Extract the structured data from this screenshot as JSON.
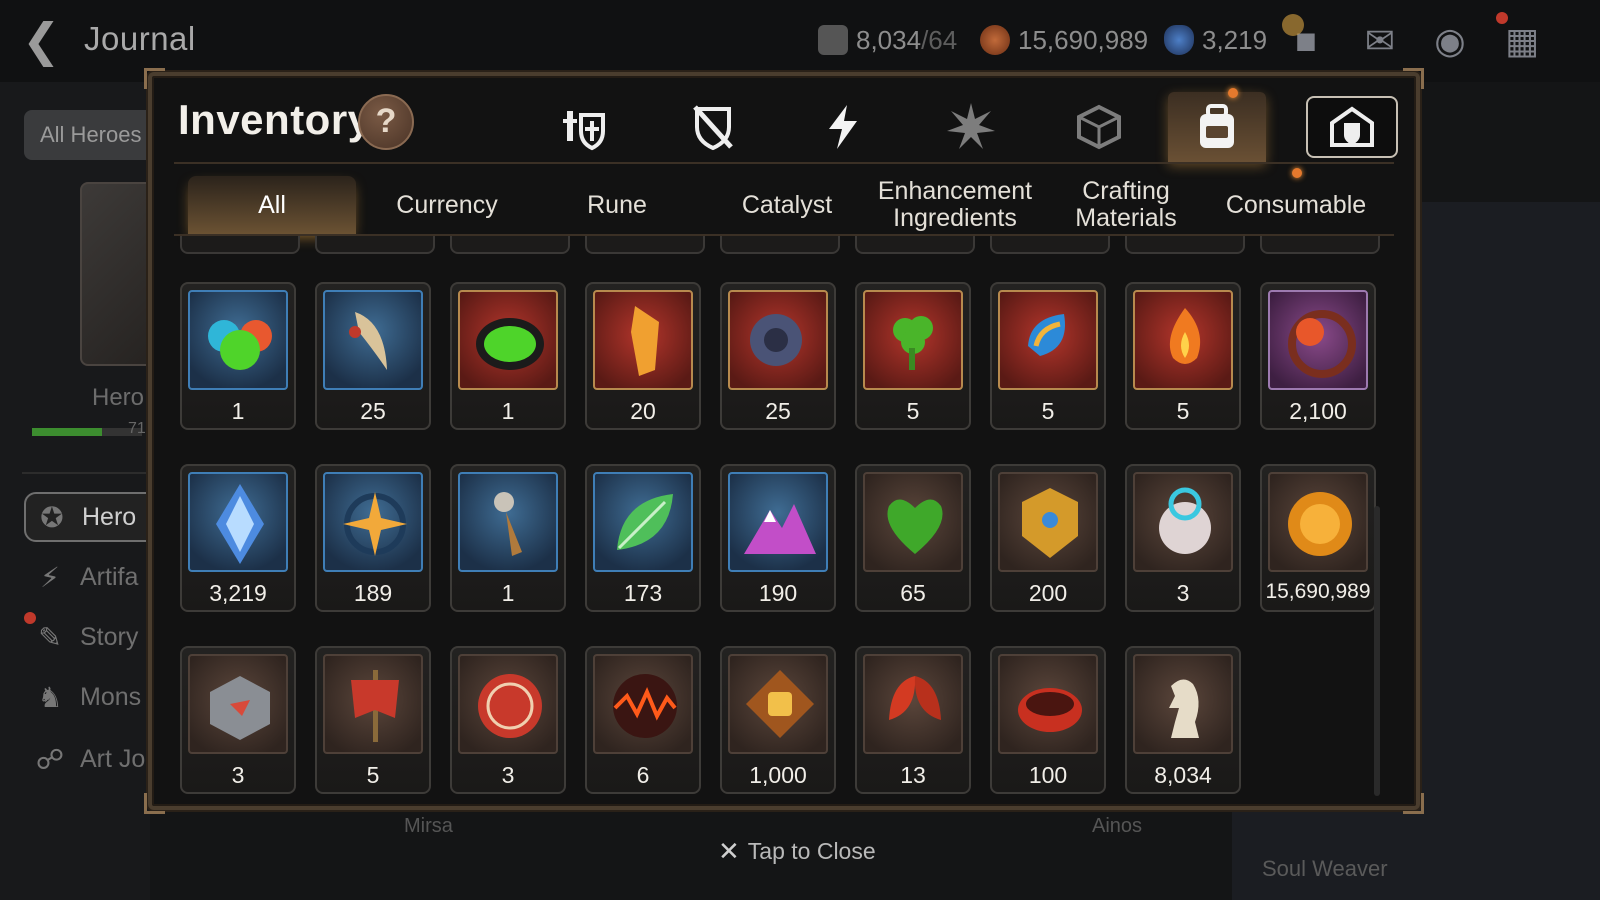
{
  "header": {
    "title": "Journal",
    "resources": [
      {
        "name": "stamina",
        "value": "8,034",
        "max": "/64",
        "color": "#8a8a8a"
      },
      {
        "name": "gold",
        "value": "15,690,989",
        "color": "#a0522d"
      },
      {
        "name": "skystone",
        "value": "3,219",
        "color": "#3b6cb5"
      }
    ]
  },
  "sidebar": {
    "filter_button": "All Heroes",
    "hero_label": "Hero",
    "progress_value": "71",
    "progress_fraction": 0.64,
    "items": [
      {
        "label": "Hero",
        "icon": "hero-icon"
      },
      {
        "label": "Artifa",
        "icon": "artifact-icon"
      },
      {
        "label": "Story",
        "icon": "story-icon"
      },
      {
        "label": "Mons",
        "icon": "monster-icon"
      },
      {
        "label": "Art Jo",
        "icon": "art-journal-icon"
      }
    ]
  },
  "background_labels": {
    "left_name": "Mirsa",
    "right_name": "Ainos",
    "soul_weaver": "Soul Weaver"
  },
  "inventory": {
    "title": "Inventory",
    "help": "?",
    "category_tabs": [
      {
        "icon": "knight-shield-icon"
      },
      {
        "icon": "crossed-weapon-shield-icon"
      },
      {
        "icon": "lightning-icon"
      },
      {
        "icon": "star-burst-icon"
      },
      {
        "icon": "cube-icon"
      },
      {
        "icon": "backpack-icon"
      },
      {
        "icon": "fortress-icon"
      }
    ],
    "subtabs": [
      {
        "label": "All"
      },
      {
        "label": "Currency"
      },
      {
        "label": "Rune"
      },
      {
        "label": "Catalyst"
      },
      {
        "label": "Enhancement Ingredients"
      },
      {
        "label": "Crafting Materials"
      },
      {
        "label": "Consumable"
      }
    ],
    "rows": [
      [
        {
          "qty": "1",
          "icon": "slime-orbs-icon"
        },
        {
          "qty": "25",
          "icon": "ginseng-root-icon"
        },
        {
          "qty": "1",
          "icon": "green-potion-icon"
        },
        {
          "qty": "20",
          "icon": "amber-crystal-icon"
        },
        {
          "qty": "25",
          "icon": "dark-amulet-icon"
        },
        {
          "qty": "5",
          "icon": "clover-amulet-icon"
        },
        {
          "qty": "5",
          "icon": "blue-drop-amulet-icon"
        },
        {
          "qty": "5",
          "icon": "fire-amulet-icon"
        },
        {
          "qty": "2,100",
          "icon": "flower-charm-icon"
        }
      ],
      [
        {
          "qty": "3,219",
          "icon": "skystone-icon"
        },
        {
          "qty": "189",
          "icon": "star-compass-icon"
        },
        {
          "qty": "1",
          "icon": "pendant-key-icon"
        },
        {
          "qty": "173",
          "icon": "green-leaf-icon"
        },
        {
          "qty": "190",
          "icon": "crystal-mountain-icon"
        },
        {
          "qty": "65",
          "icon": "green-heart-icon"
        },
        {
          "qty": "200",
          "icon": "golden-emblem-icon"
        },
        {
          "qty": "3",
          "icon": "robot-pod-icon"
        },
        {
          "qty": "15,690,989",
          "icon": "gold-coin-icon"
        }
      ],
      [
        {
          "qty": "3",
          "icon": "stone-cube-icon"
        },
        {
          "qty": "5",
          "icon": "war-banner-icon"
        },
        {
          "qty": "3",
          "icon": "red-seal-icon"
        },
        {
          "qty": "6",
          "icon": "fire-orb-icon"
        },
        {
          "qty": "1,000",
          "icon": "fist-badge-icon"
        },
        {
          "qty": "13",
          "icon": "red-leaves-icon"
        },
        {
          "qty": "100",
          "icon": "red-ring-icon"
        },
        {
          "qty": "8,034",
          "icon": "chess-knight-icon"
        }
      ]
    ]
  },
  "footer": {
    "close_hint": "Tap to Close"
  }
}
